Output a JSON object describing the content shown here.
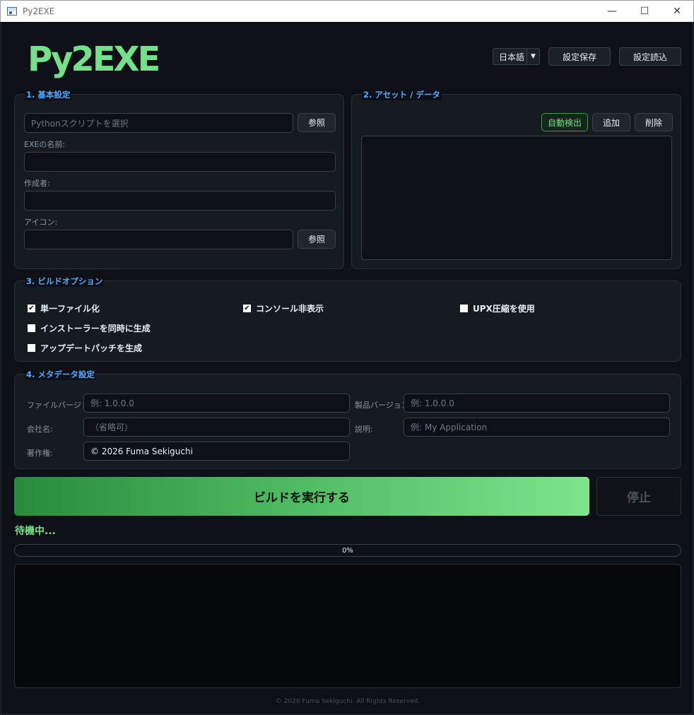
{
  "window": {
    "title": "Py2EXE"
  },
  "header": {
    "logo": "Py2EXE",
    "language": "日本語",
    "save_settings": "設定保存",
    "load_settings": "設定読込"
  },
  "basic": {
    "title": "1. 基本設定",
    "script_placeholder": "Pythonスクリプトを選択",
    "browse": "参照",
    "exe_name_label": "EXEの名前:",
    "author_label": "作成者:",
    "icon_label": "アイコン:",
    "icon_browse": "参照"
  },
  "assets": {
    "title": "2. アセット / データ",
    "auto_detect": "自動検出",
    "add": "追加",
    "remove": "削除"
  },
  "build_options": {
    "title": "3. ビルドオプション",
    "onefile": {
      "label": "単一ファイル化",
      "checked": true
    },
    "noconsole": {
      "label": "コンソール非表示",
      "checked": true
    },
    "upx": {
      "label": "UPX圧縮を使用",
      "checked": false
    },
    "installer": {
      "label": "インストーラーを同時に生成",
      "checked": false
    },
    "patch": {
      "label": "アップデートパッチを生成",
      "checked": false
    }
  },
  "metadata": {
    "title": "4. メタデータ設定",
    "file_version_label": "ファイルバージョン:",
    "file_version_placeholder": "例: 1.0.0.0",
    "product_version_label": "製品バージョン:",
    "product_version_placeholder": "例: 1.0.0.0",
    "company_label": "会社名:",
    "company_placeholder": "（省略可）",
    "description_label": "説明:",
    "description_placeholder": "例: My Application",
    "copyright_label": "著作権:",
    "copyright_value": "© 2026 Fuma Sekiguchi"
  },
  "actions": {
    "run": "ビルドを実行する",
    "stop": "停止"
  },
  "status": {
    "text": "待機中...",
    "progress": 0,
    "progress_label": "0%"
  },
  "footer": "© 2026 Fuma Sekiguchi. All Rights Reserved.",
  "colors": {
    "accent_green": "#74e08a",
    "section_title": "#58a6ff",
    "background": "#0d1117"
  }
}
